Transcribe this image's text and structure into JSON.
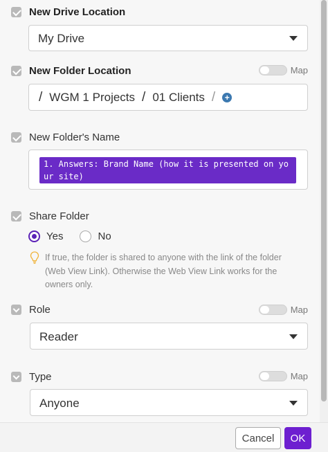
{
  "drive": {
    "label": "New Drive Location",
    "value": "My Drive"
  },
  "folder_location": {
    "label": "New Folder Location",
    "map_label": "Map",
    "path": [
      "WGM 1 Projects",
      "01 Clients"
    ]
  },
  "folder_name": {
    "label": "New Folder's Name",
    "value": "1. Answers: Brand Name (how it is presented on your site)"
  },
  "share": {
    "label": "Share Folder",
    "yes": "Yes",
    "no": "No",
    "selected": "Yes",
    "hint": "If true, the folder is shared to anyone with the link of the folder (Web View Link). Otherwise the Web View Link works for the owners only."
  },
  "role": {
    "label": "Role",
    "map_label": "Map",
    "value": "Reader"
  },
  "type": {
    "label": "Type",
    "map_label": "Map",
    "value": "Anyone"
  },
  "footer": {
    "cancel": "Cancel",
    "ok": "OK"
  },
  "colors": {
    "accent": "#6d1fd0",
    "pill": "#6a2bc7",
    "plus": "#3c79b0"
  }
}
